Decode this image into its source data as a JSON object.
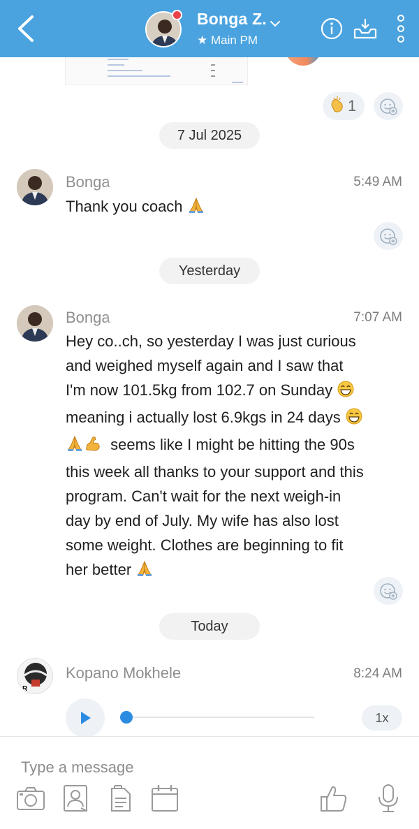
{
  "header": {
    "name": "Bonga Z.",
    "subtitle": "★ Main PM",
    "colors": {
      "bar": "#4aa3df",
      "online_dot": "#e8424a"
    }
  },
  "top_reactions": {
    "count": "1"
  },
  "dates": {
    "d1": "7 Jul 2025",
    "d2": "Yesterday",
    "d3": "Today"
  },
  "messages": [
    {
      "sender": "Bonga",
      "time": "5:49 AM",
      "text": "Thank you coach"
    },
    {
      "sender": "Bonga",
      "time": "7:07 AM",
      "lines": [
        "Hey co..ch, so yesterday I was just curious",
        "and weighed myself again and I saw that",
        "I'm now 101.5kg from 102.7 on Sunday",
        "meaning i actually lost 6.9kgs in 24 days",
        "seems like I might be hitting the 90s",
        "this week all thanks to your support and this",
        "program. Can't wait for the next weigh-in",
        "day by end of July. My wife has also lost",
        "some weight. Clothes are beginning to fit",
        "her better"
      ]
    },
    {
      "sender": "Kopano Mokhele",
      "time": "8:24 AM",
      "voice_speed": "1x",
      "voice_progress": 0
    }
  ],
  "composer": {
    "placeholder": "Type a message"
  },
  "icons": {
    "back": "chevron-left-icon",
    "info": "info-icon",
    "inbox": "download-tray-icon",
    "more": "more-vertical-icon",
    "camera": "camera-icon",
    "contact": "contact-card-icon",
    "document": "document-icon",
    "calendar": "calendar-icon",
    "like": "thumbs-up-icon",
    "mic": "microphone-icon",
    "play": "play-icon",
    "add_reaction": "add-reaction-icon"
  }
}
